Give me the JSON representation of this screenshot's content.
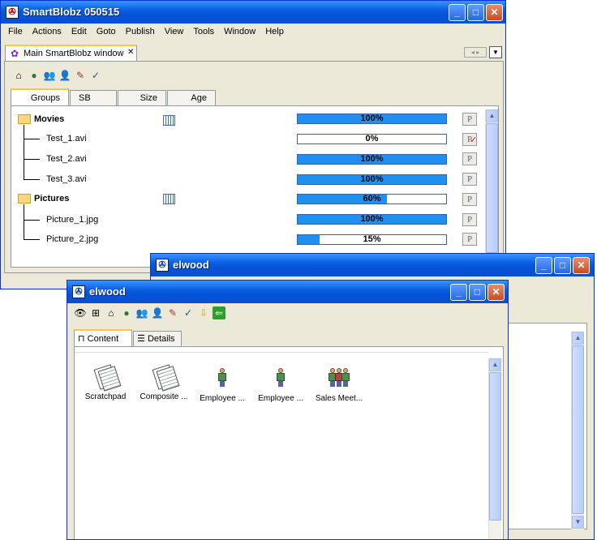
{
  "main_window": {
    "title": "SmartBlobz 050515",
    "menu": [
      "File",
      "Actions",
      "Edit",
      "Goto",
      "Publish",
      "View",
      "Tools",
      "Window",
      "Help"
    ],
    "doc_tab": "Main SmartBlobz window",
    "tabs": [
      "Groups",
      "SB types",
      "Size",
      "Age"
    ],
    "rows": [
      {
        "name": "Movies",
        "type": "folder",
        "progress": "100%",
        "fill": 1.0,
        "p": "P"
      },
      {
        "name": "Test_1.avi",
        "type": "file",
        "progress": "0%",
        "fill": 0.0,
        "p": "P"
      },
      {
        "name": "Test_2.avi",
        "type": "file",
        "progress": "100%",
        "fill": 1.0,
        "p": "P"
      },
      {
        "name": "Test_3.avi",
        "type": "file",
        "progress": "100%",
        "fill": 1.0,
        "p": "P"
      },
      {
        "name": "Pictures",
        "type": "folder",
        "progress": "60%",
        "fill": 0.6,
        "p": "P"
      },
      {
        "name": "Picture_1.jpg",
        "type": "file",
        "progress": "100%",
        "fill": 1.0,
        "p": "P"
      },
      {
        "name": "Picture_2.jpg",
        "type": "file",
        "progress": "15%",
        "fill": 0.15,
        "p": "P"
      }
    ]
  },
  "back_window": {
    "title": "elwood"
  },
  "front_window": {
    "title": "elwood",
    "tabs": [
      "Content",
      "Details"
    ],
    "items": [
      {
        "label": "Scratchpad",
        "icon": "scratchpad-icon"
      },
      {
        "label": "Composite ...",
        "icon": "composite-icon"
      },
      {
        "label": "Employee ...",
        "icon": "employee-icon"
      },
      {
        "label": "Employee ...",
        "icon": "employee-icon"
      },
      {
        "label": "Sales Meet...",
        "icon": "group-icon"
      }
    ]
  },
  "colors": {
    "title_blue": "#0553d8",
    "progress_fill": "#1f8ff2",
    "tab_highlight": "#ffc83c"
  }
}
